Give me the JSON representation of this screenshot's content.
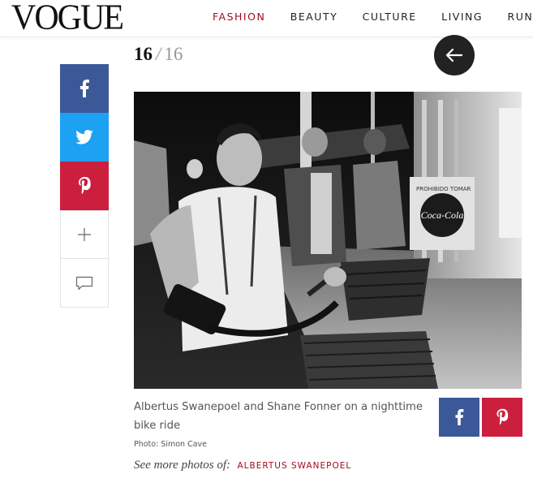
{
  "header": {
    "logo": "VOGUE",
    "nav": [
      {
        "label": "FASHION",
        "active": true
      },
      {
        "label": "BEAUTY",
        "active": false
      },
      {
        "label": "CULTURE",
        "active": false
      },
      {
        "label": "LIVING",
        "active": false
      },
      {
        "label": "RUNWAY",
        "active": false
      }
    ]
  },
  "gallery": {
    "current": "16",
    "separator": "/",
    "total": "16"
  },
  "share_bar": {
    "icons": [
      "facebook-icon",
      "twitter-icon",
      "pinterest-icon",
      "plus-icon",
      "comment-icon"
    ]
  },
  "photo": {
    "sign_text_1": "PROHIBIDO TOMAR",
    "sign_logo": "Coca-Cola"
  },
  "caption": {
    "text": "Albertus Swanepoel and Shane Fonner on a nighttime bike ride",
    "credit": "Photo: Simon Cave",
    "more_label": "See more photos of:",
    "more_link": "ALBERTUS SWANEPOEL"
  },
  "colors": {
    "brand_red": "#a30b1f",
    "facebook": "#3b5998",
    "twitter": "#1da1f2",
    "pinterest": "#cb1f3d"
  }
}
